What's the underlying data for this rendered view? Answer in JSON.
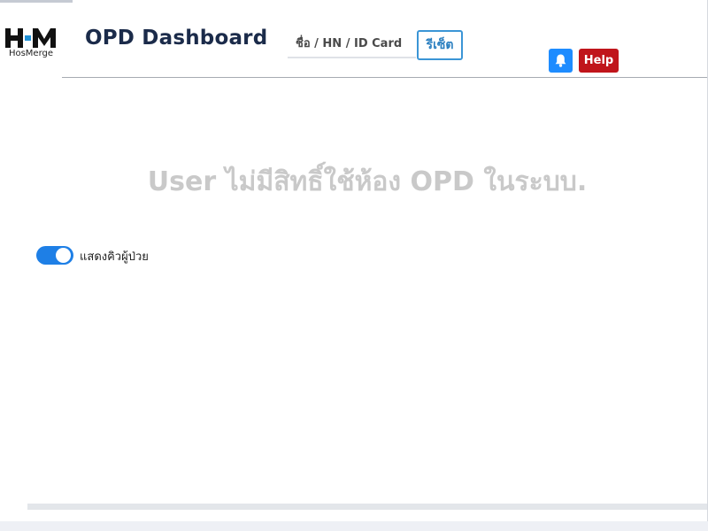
{
  "logo": {
    "mark": "HM",
    "text": "HosMerge"
  },
  "header": {
    "title": "OPD Dashboard",
    "search_placeholder": "ชื่อ / HN / ID Card",
    "reset_label": "รีเซ็ต",
    "bell_icon": "bell-icon",
    "help_label": "Help"
  },
  "main": {
    "message": "User ไม่มีสิทธิ์ใช้ห้อง OPD ในระบบ.",
    "toggle": {
      "label": "แสดงคิวผู้ป่วย",
      "checked": true
    }
  },
  "colors": {
    "brand_dark": "#1b2b4a",
    "primary": "#1e8cff",
    "danger": "#c0151b",
    "logo_dot": "#1e90d6"
  }
}
